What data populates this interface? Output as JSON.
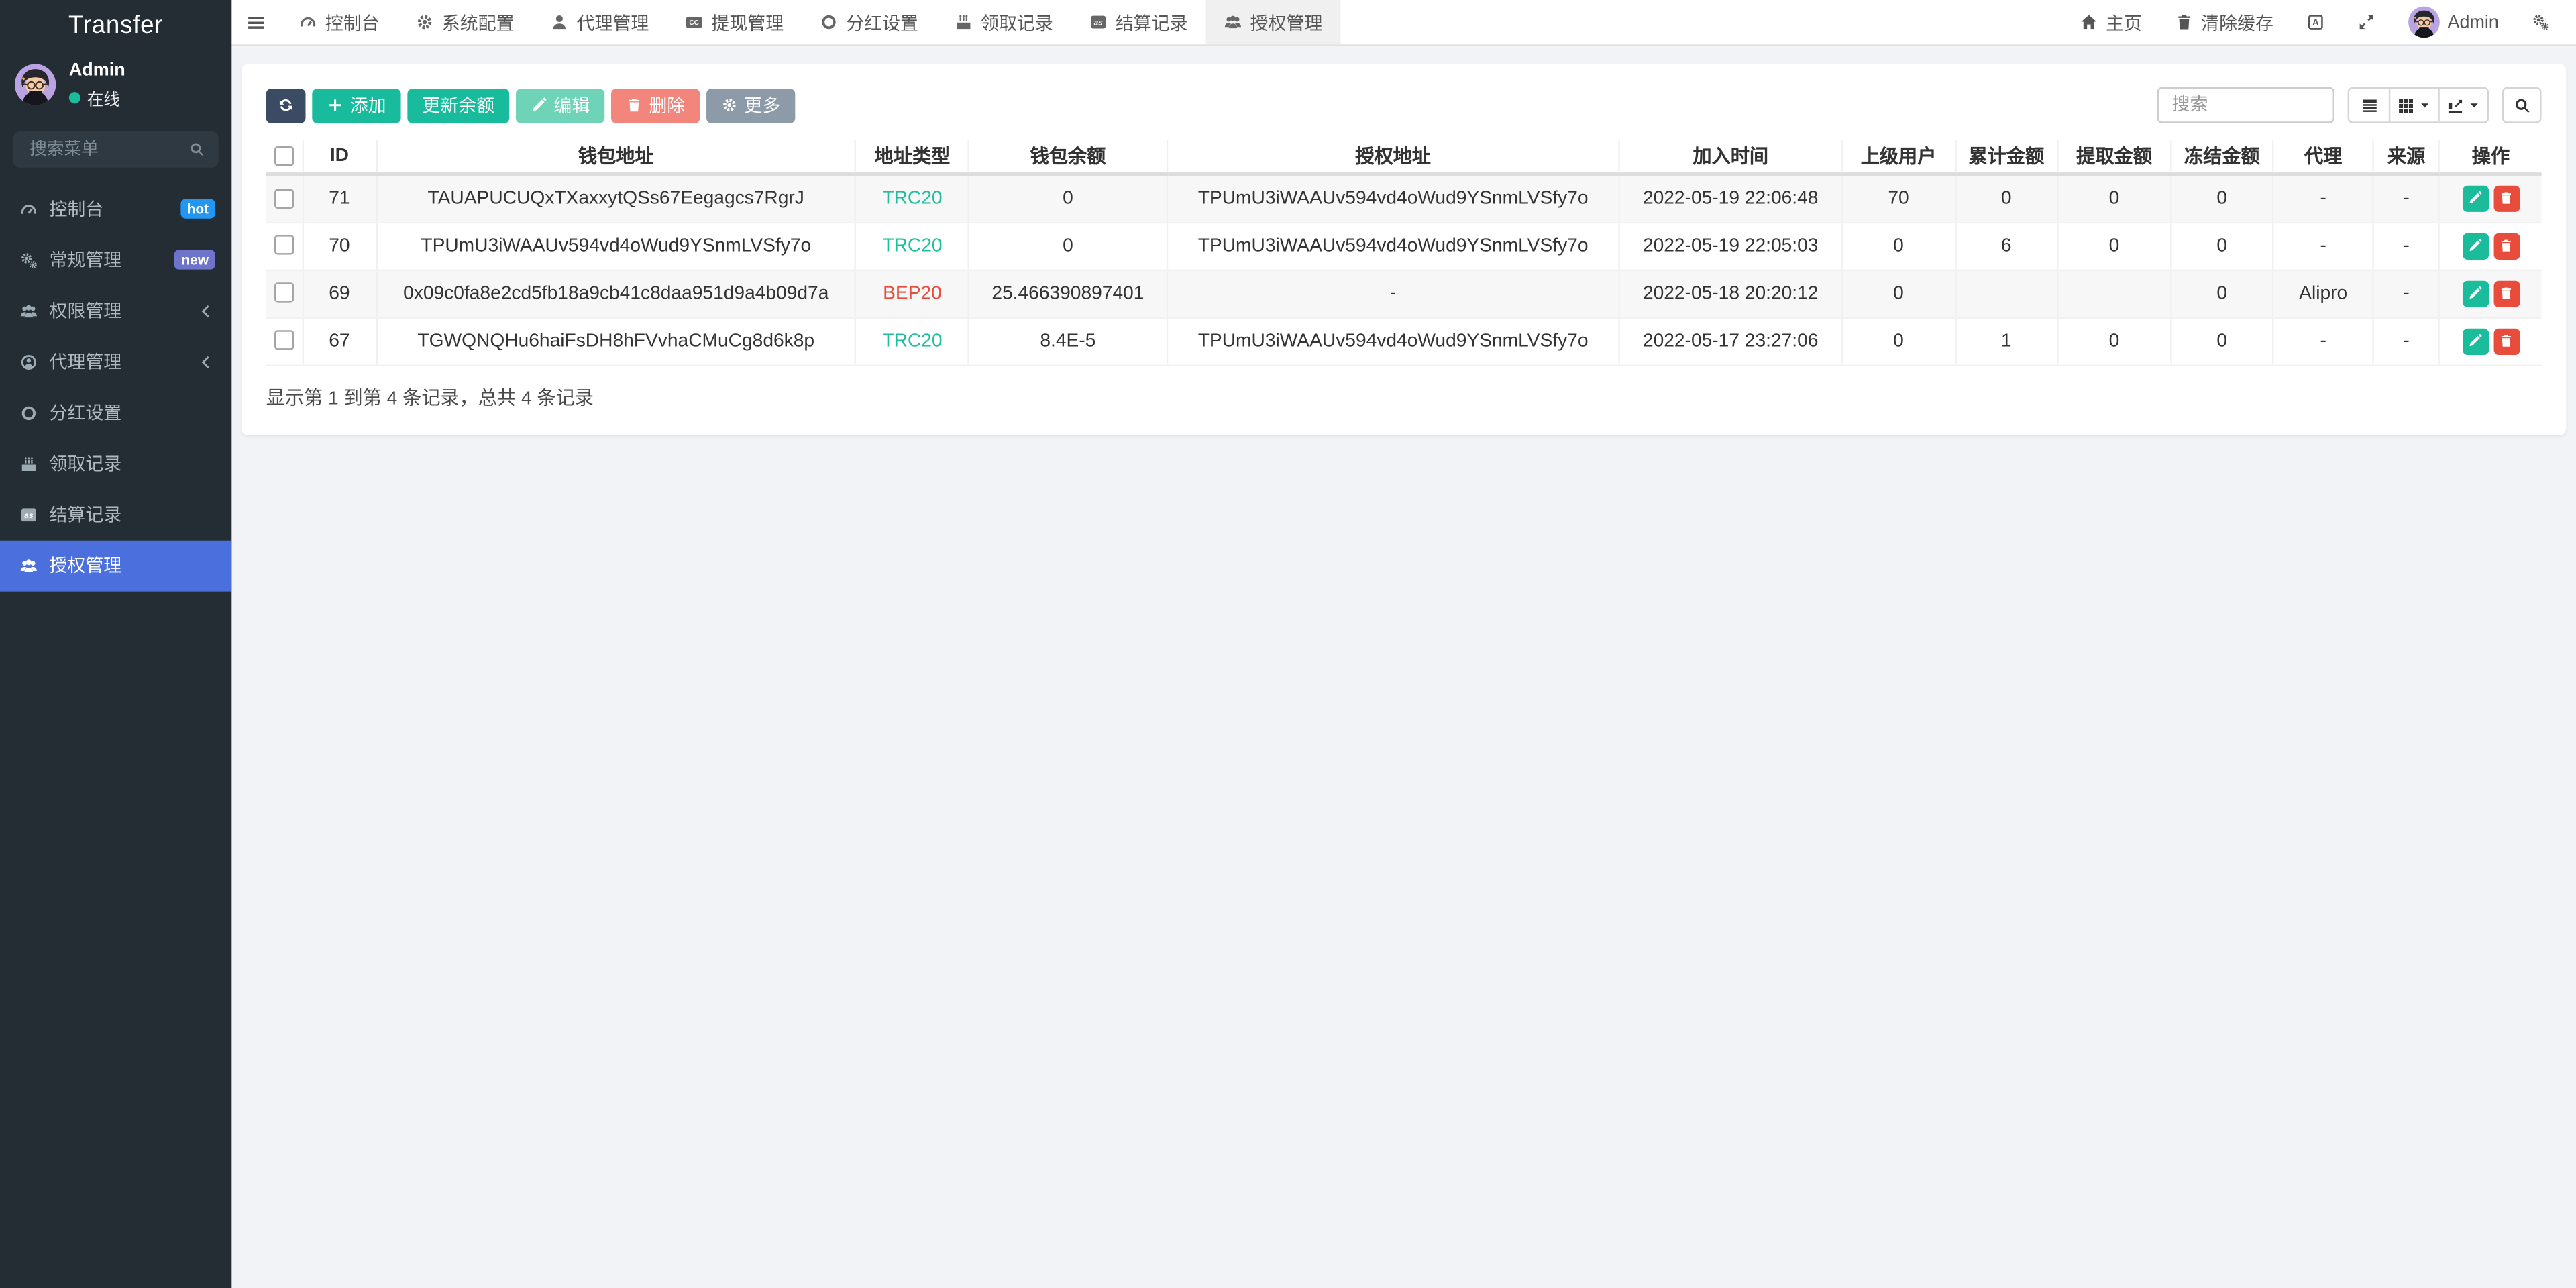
{
  "brand": "Transfer",
  "colors": {
    "sidebar_bg": "#232d33",
    "active_menu_bg": "#4b70dd",
    "badge_hot": "#2196f3",
    "badge_new": "#6e74c9",
    "btn_primary": "#3c4b64",
    "btn_success": "#18bc9c",
    "btn_danger": "#e74c3c",
    "btn_more": "#8d9aa8",
    "trc20_text": "#1dbf9d",
    "bep20_text": "#e74c3c",
    "online_dot": "#1abc9c"
  },
  "sidebar": {
    "user_name": "Admin",
    "user_status": "在线",
    "search_placeholder": "搜索菜单",
    "items": [
      {
        "label": "控制台",
        "icon": "dashboard-icon",
        "badge": "hot"
      },
      {
        "label": "常规管理",
        "icon": "gears-icon",
        "badge": "new"
      },
      {
        "label": "权限管理",
        "icon": "user-group-icon",
        "collapsible": true
      },
      {
        "label": "代理管理",
        "icon": "user-circle-icon",
        "collapsible": true
      },
      {
        "label": "分红设置",
        "icon": "circle-icon"
      },
      {
        "label": "领取记录",
        "icon": "cake-icon"
      },
      {
        "label": "结算记录",
        "icon": "settlement-icon"
      },
      {
        "label": "授权管理",
        "icon": "user-group-icon",
        "active": true
      }
    ]
  },
  "topnav": {
    "tabs": [
      {
        "label": "控制台"
      },
      {
        "label": "系统配置"
      },
      {
        "label": "代理管理"
      },
      {
        "label": "提现管理"
      },
      {
        "label": "分红设置"
      },
      {
        "label": "领取记录"
      },
      {
        "label": "结算记录"
      },
      {
        "label": "授权管理",
        "active": true
      }
    ],
    "home_label": "主页",
    "clear_cache_label": "清除缓存",
    "username": "Admin"
  },
  "toolbar": {
    "add_label": "添加",
    "update_balance_label": "更新余额",
    "edit_label": "编辑",
    "delete_label": "删除",
    "more_label": "更多",
    "search_placeholder": "搜索"
  },
  "table": {
    "columns": [
      "ID",
      "钱包地址",
      "地址类型",
      "钱包余额",
      "授权地址",
      "加入时间",
      "上级用户",
      "累计金额",
      "提取金额",
      "冻结金额",
      "代理",
      "来源",
      "操作"
    ],
    "rows": [
      {
        "id": "71",
        "wallet": "TAUAPUCUQxTXaxxytQSs67Eegagcs7RgrJ",
        "type": "TRC20",
        "balance": "0",
        "auth": "TPUmU3iWAAUv594vd4oWud9YSnmLVSfy7o",
        "joined": "2022-05-19 22:06:48",
        "parent": "70",
        "total": "0",
        "withdrawn": "0",
        "frozen": "0",
        "agent": "-",
        "source": "-"
      },
      {
        "id": "70",
        "wallet": "TPUmU3iWAAUv594vd4oWud9YSnmLVSfy7o",
        "type": "TRC20",
        "balance": "0",
        "auth": "TPUmU3iWAAUv594vd4oWud9YSnmLVSfy7o",
        "joined": "2022-05-19 22:05:03",
        "parent": "0",
        "total": "6",
        "withdrawn": "0",
        "frozen": "0",
        "agent": "-",
        "source": "-"
      },
      {
        "id": "69",
        "wallet": "0x09c0fa8e2cd5fb18a9cb41c8daa951d9a4b09d7a",
        "type": "BEP20",
        "balance": "25.466390897401",
        "auth": "-",
        "joined": "2022-05-18 20:20:12",
        "parent": "0",
        "total": "",
        "withdrawn": "",
        "frozen": "0",
        "agent": "Alipro",
        "source": "-"
      },
      {
        "id": "67",
        "wallet": "TGWQNQHu6haiFsDH8hFVvhaCMuCg8d6k8p",
        "type": "TRC20",
        "balance": "8.4E-5",
        "auth": "TPUmU3iWAAUv594vd4oWud9YSnmLVSfy7o",
        "joined": "2022-05-17 23:27:06",
        "parent": "0",
        "total": "1",
        "withdrawn": "0",
        "frozen": "0",
        "agent": "-",
        "source": "-"
      }
    ],
    "footer_info": "显示第 1 到第 4 条记录，总共 4 条记录"
  }
}
